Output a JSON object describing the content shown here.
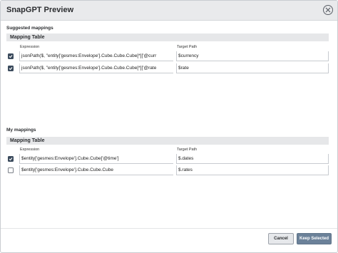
{
  "dialog": {
    "title": "SnapGPT Preview",
    "close_icon": "close-circle-icon"
  },
  "suggested": {
    "section_label": "Suggested mappings",
    "table_title": "Mapping Table",
    "col_expression": "Expression",
    "col_target": "Target Path",
    "rows": [
      {
        "checked": true,
        "expression": "jsonPath($, \"entity['gesmes:Envelope'].Cube.Cube.Cube[*]['@curr",
        "target": "$currency"
      },
      {
        "checked": true,
        "expression": "jsonPath($, \"entity['gesmes:Envelope'].Cube.Cube.Cube[*]['@rate",
        "target": "$rate"
      }
    ]
  },
  "mine": {
    "section_label": "My mappings",
    "table_title": "Mapping Table",
    "col_expression": "Expression",
    "col_target": "Target Path",
    "rows": [
      {
        "checked": true,
        "expression": "$entity['gesmes:Envelope'].Cube.Cube['@time']",
        "target": "$.dates"
      },
      {
        "checked": false,
        "expression": "$entity['gesmes:Envelope'].Cube.Cube.Cube",
        "target": "$.rates"
      }
    ]
  },
  "footer": {
    "cancel_label": "Cancel",
    "keep_label": "Keep Selected"
  },
  "colors": {
    "primary_button": "#6b8199",
    "checkbox_checked": "#3a4a5c",
    "header_bg": "#e9eaec"
  }
}
